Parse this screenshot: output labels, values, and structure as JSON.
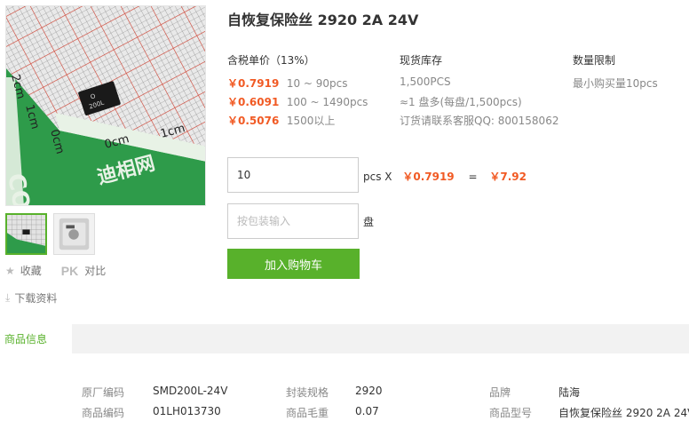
{
  "product": {
    "title": "自恢复保险丝 2920 2A 24V",
    "image_label": "200L",
    "brand_watermark": "迪相网"
  },
  "gallery": {
    "thumbnails": [
      "product-photo",
      "package-photo"
    ]
  },
  "actions": {
    "favorite": "收藏",
    "pk_icon": "PK",
    "compare": "对比",
    "download": "下载资料"
  },
  "pricing": {
    "header": "含税单价（13%）",
    "tiers": [
      {
        "price": "￥0.7919",
        "range": "10 ~ 90pcs"
      },
      {
        "price": "￥0.6091",
        "range": "100 ~ 1490pcs"
      },
      {
        "price": "￥0.5076",
        "range": "1500以上"
      }
    ]
  },
  "stock": {
    "header": "现货库存",
    "quantity": "1,500PCS",
    "per_reel": "≈1 盘多(每盘/1,500pcs)",
    "contact": "订货请联系客服QQ: 800158062"
  },
  "limit": {
    "header": "数量限制",
    "min": "最小购买量10pcs"
  },
  "order": {
    "quantity": "10",
    "unit_text": "pcs X",
    "unit_price": "￥0.7919",
    "equals": "=",
    "total": "￥7.92",
    "pack_placeholder": "按包装输入",
    "pack_unit": "盘",
    "add_to_cart": "加入购物车"
  },
  "tabs": {
    "active": "商品信息"
  },
  "info": {
    "rows": [
      [
        {
          "label": "原厂编码",
          "value": "SMD200L-24V"
        },
        {
          "label": "封装规格",
          "value": "2920"
        },
        {
          "label": "品牌",
          "value": "陆海"
        }
      ],
      [
        {
          "label": "商品编码",
          "value": "01LH013730"
        },
        {
          "label": "商品毛重",
          "value": "0.07"
        },
        {
          "label": "商品型号",
          "value": "自恢复保险丝 2920 2A 24V"
        }
      ]
    ]
  },
  "colors": {
    "accent_green": "#58b12b",
    "price_orange": "#f15a24",
    "muted_text": "#888888"
  }
}
